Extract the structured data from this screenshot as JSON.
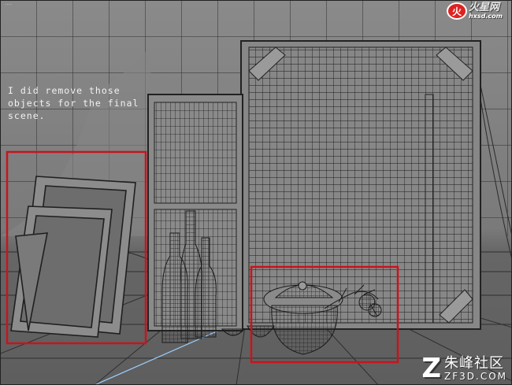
{
  "viewport": {
    "annotation": "I did remove those objects for the final scene.",
    "corner_label": "....",
    "highlight_color": "#c8141e"
  },
  "watermarks": {
    "top_mark": "火",
    "top_cn": "火星网",
    "top_en": "hxsd.com",
    "bottom_mark": "Z",
    "bottom_cn": "朱峰社区",
    "bottom_en": "ZF3D.COM"
  }
}
